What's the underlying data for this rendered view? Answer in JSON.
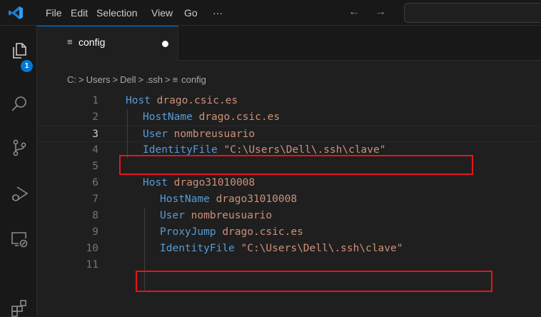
{
  "menu": {
    "items": [
      "File",
      "Edit",
      "Selection",
      "View",
      "Go",
      "···"
    ],
    "back": "←",
    "forward": "→"
  },
  "activity_bar": {
    "icons": [
      "explorer-icon",
      "search-icon",
      "source-control-icon",
      "run-debug-icon",
      "remote-explorer-icon",
      "extensions-icon"
    ],
    "explorer_badge": "1"
  },
  "tab": {
    "icon": "≡",
    "label": "config"
  },
  "breadcrumb": {
    "items": [
      "C:",
      "Users",
      "Dell",
      ".ssh",
      "config"
    ],
    "separator": ">",
    "file_icon": "≡"
  },
  "editor": {
    "current_line": 3,
    "lines": [
      {
        "num": "1",
        "key": "Host",
        "value": "drago.csic.es"
      },
      {
        "num": "2",
        "key": "HostName",
        "value": "drago.csic.es"
      },
      {
        "num": "3",
        "key": "User",
        "value": "nombreusuario"
      },
      {
        "num": "4",
        "key": "IdentityFile",
        "value": "\"C:\\Users\\Dell\\.ssh\\clave\""
      },
      {
        "num": "5",
        "key": "",
        "value": ""
      },
      {
        "num": "6",
        "key": "Host",
        "value": "drago31010008"
      },
      {
        "num": "7",
        "key": "HostName",
        "value": "drago31010008"
      },
      {
        "num": "8",
        "key": "User",
        "value": "nombreusuario"
      },
      {
        "num": "9",
        "key": "ProxyJump",
        "value": "drago.csic.es"
      },
      {
        "num": "10",
        "key": "IdentityFile",
        "value": "\"C:\\Users\\Dell\\.ssh\\clave\""
      },
      {
        "num": "11",
        "key": "",
        "value": ""
      }
    ]
  },
  "colors": {
    "accent": "#0078d4",
    "highlight_box": "#e8141a",
    "keyword": "#569cd6",
    "string": "#ce9178"
  }
}
